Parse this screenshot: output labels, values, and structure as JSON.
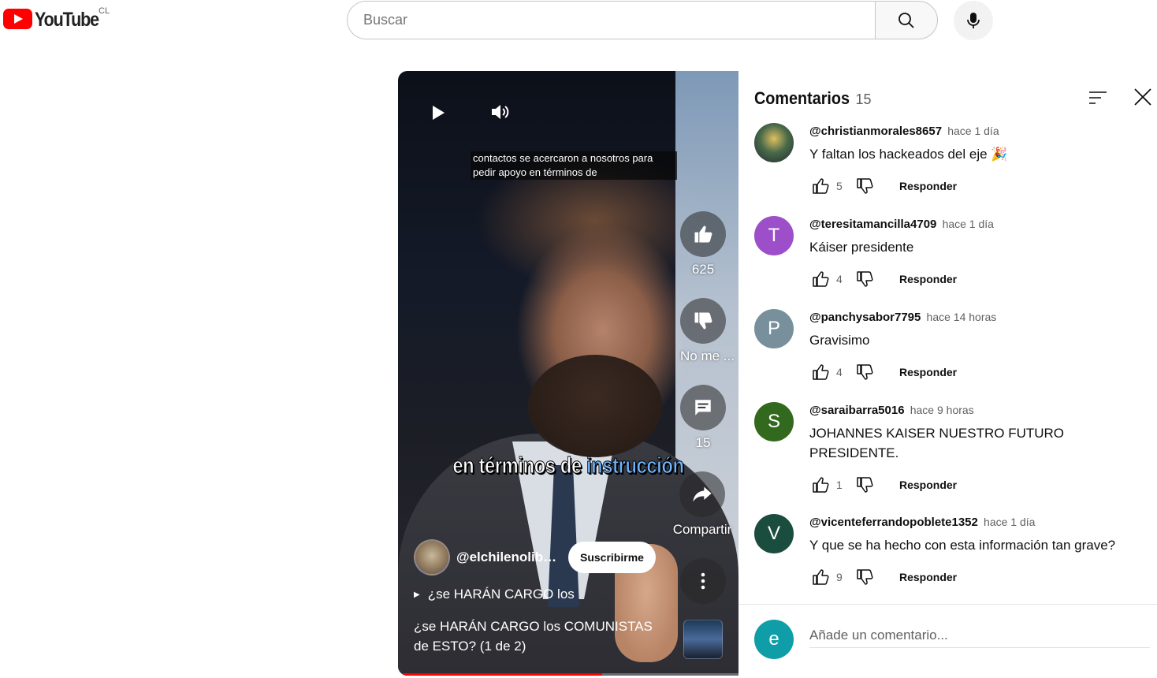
{
  "header": {
    "logo_text": "YouTube",
    "country_code": "CL",
    "search_placeholder": "Buscar"
  },
  "short": {
    "caption_top": "contactos se acercaron a nosotros para pedir apoyo en términos de",
    "caption_big_before": "en términos de ",
    "caption_big_highlight": "instrucción",
    "actions": {
      "like_count": "625",
      "dislike_label": "No me ...",
      "comment_count": "15",
      "share_label": "Compartir"
    },
    "channel_name": "@elchilenolibe...",
    "subscribe_label": "Suscribirme",
    "description": "¿se HARÁN CARGO los",
    "title": "¿se HARÁN CARGO los COMUNISTAS de ESTO? (1 de 2)",
    "progress": 0.6
  },
  "comments": {
    "title": "Comentarios",
    "count": "15",
    "items": [
      {
        "author": "@christianmorales8657",
        "time": "hace 1 día",
        "text": "Y faltan los hackeados del eje 🎉",
        "likes": "5",
        "reply": "Responder",
        "avatar_letter": "",
        "avatar_color": "#2b3a44"
      },
      {
        "author": "@teresitamancilla4709",
        "time": "hace 1 día",
        "text": "Káiser presidente",
        "likes": "4",
        "reply": "Responder",
        "avatar_letter": "T",
        "avatar_color": "#9c4fc8"
      },
      {
        "author": "@panchysabor7795",
        "time": "hace 14 horas",
        "text": "Gravisimo",
        "likes": "4",
        "reply": "Responder",
        "avatar_letter": "P",
        "avatar_color": "#78909c"
      },
      {
        "author": "@saraibarra5016",
        "time": "hace 9 horas",
        "text": "JOHANNES KAISER NUESTRO FUTURO PRESIDENTE.",
        "likes": "1",
        "reply": "Responder",
        "avatar_letter": "S",
        "avatar_color": "#33691e"
      },
      {
        "author": "@vicenteferrandopoblete1352",
        "time": "hace 1 día",
        "text": "Y que se ha hecho con esta información tan grave?",
        "likes": "9",
        "reply": "Responder",
        "avatar_letter": "V",
        "avatar_color": "#1b4d3e"
      }
    ],
    "add_avatar_letter": "e",
    "add_placeholder": "Añade un comentario..."
  }
}
